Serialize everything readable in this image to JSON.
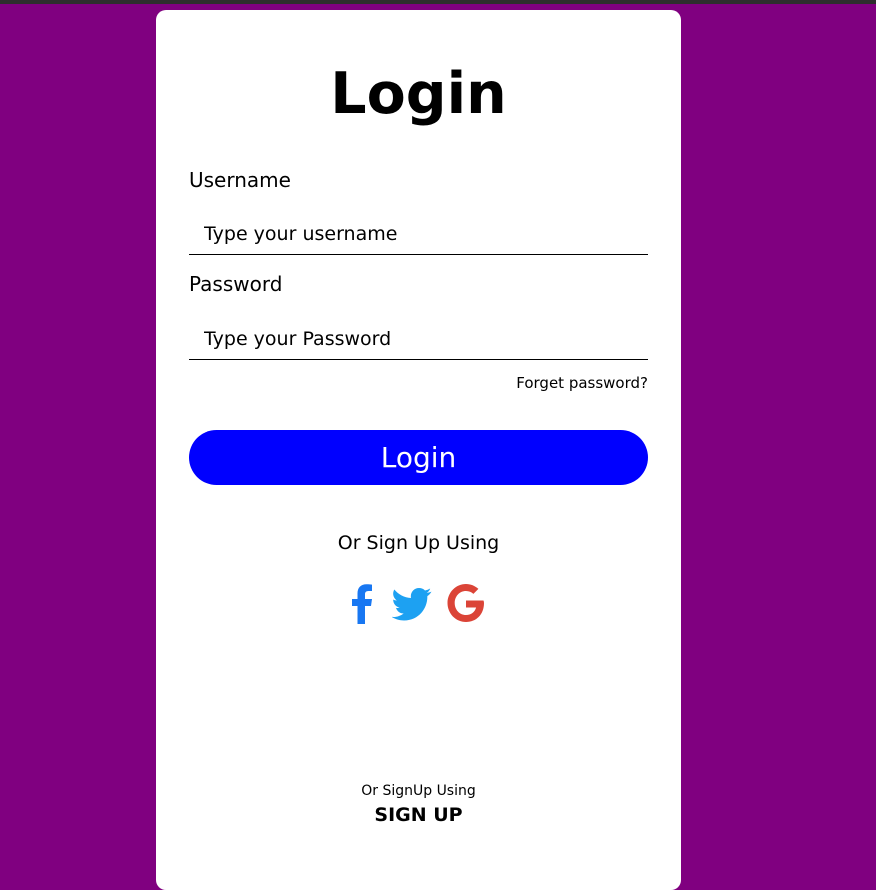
{
  "colors": {
    "background": "#800080",
    "card": "#ffffff",
    "button": "#0000ff",
    "facebook": "#1877f2",
    "twitter": "#1da1f2",
    "google": "#db4437"
  },
  "form": {
    "title": "Login",
    "username_label": "Username",
    "username_placeholder": "Type your username",
    "password_label": "Password",
    "password_placeholder": "Type your Password",
    "forgot_link": "Forget password?",
    "login_button": "Login"
  },
  "social": {
    "heading": "Or Sign Up Using",
    "icons": [
      "facebook-icon",
      "twitter-icon",
      "google-icon"
    ]
  },
  "footer": {
    "text": "Or SignUp Using",
    "signup_link": "SIGN UP"
  }
}
